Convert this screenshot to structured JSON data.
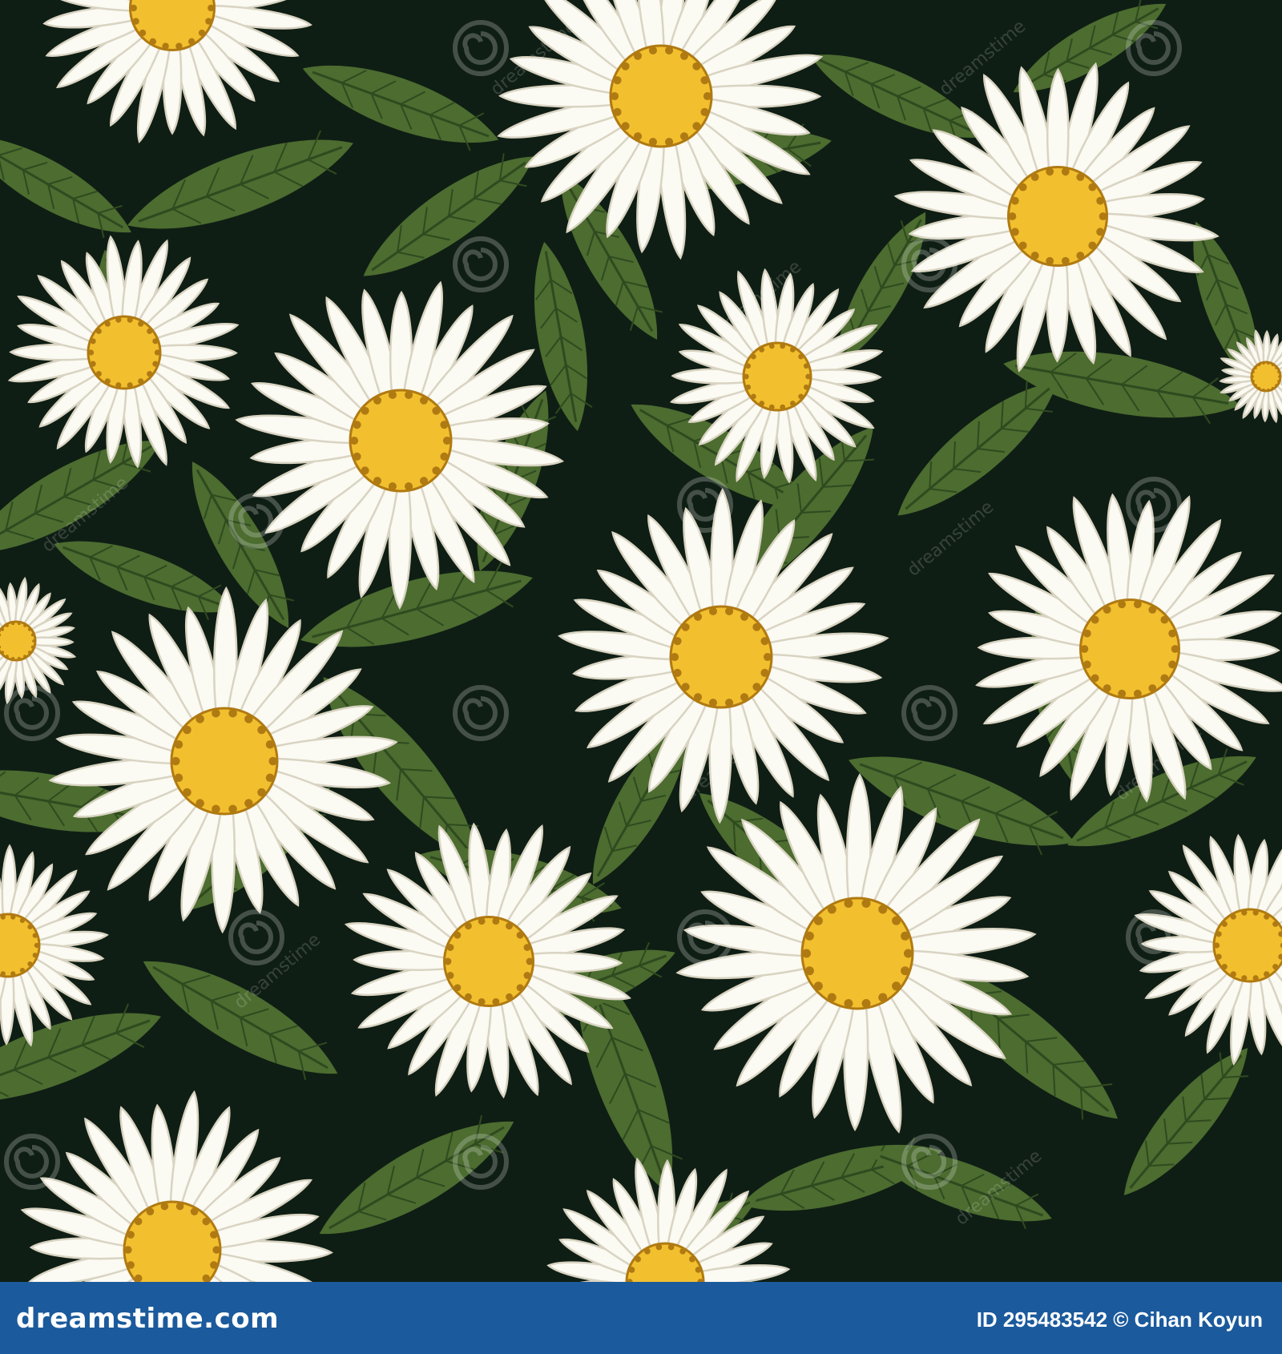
{
  "footer": {
    "brand": "dreamstime.com",
    "credit": "ID 295483542 © Cihan Koyun"
  },
  "watermark": {
    "text": "dreamstime"
  },
  "colors": {
    "background": "#0f1e14",
    "leaf": "#4c6c30",
    "petal": "#fbfaf3",
    "petal_shadow": "#d9d4c2",
    "center": "#f2c02f",
    "center_dots": "#b07a12",
    "footer": "#1b5a9c"
  },
  "icons": [
    "watermark-swirl-icon",
    "daisy-flower",
    "leaf"
  ]
}
